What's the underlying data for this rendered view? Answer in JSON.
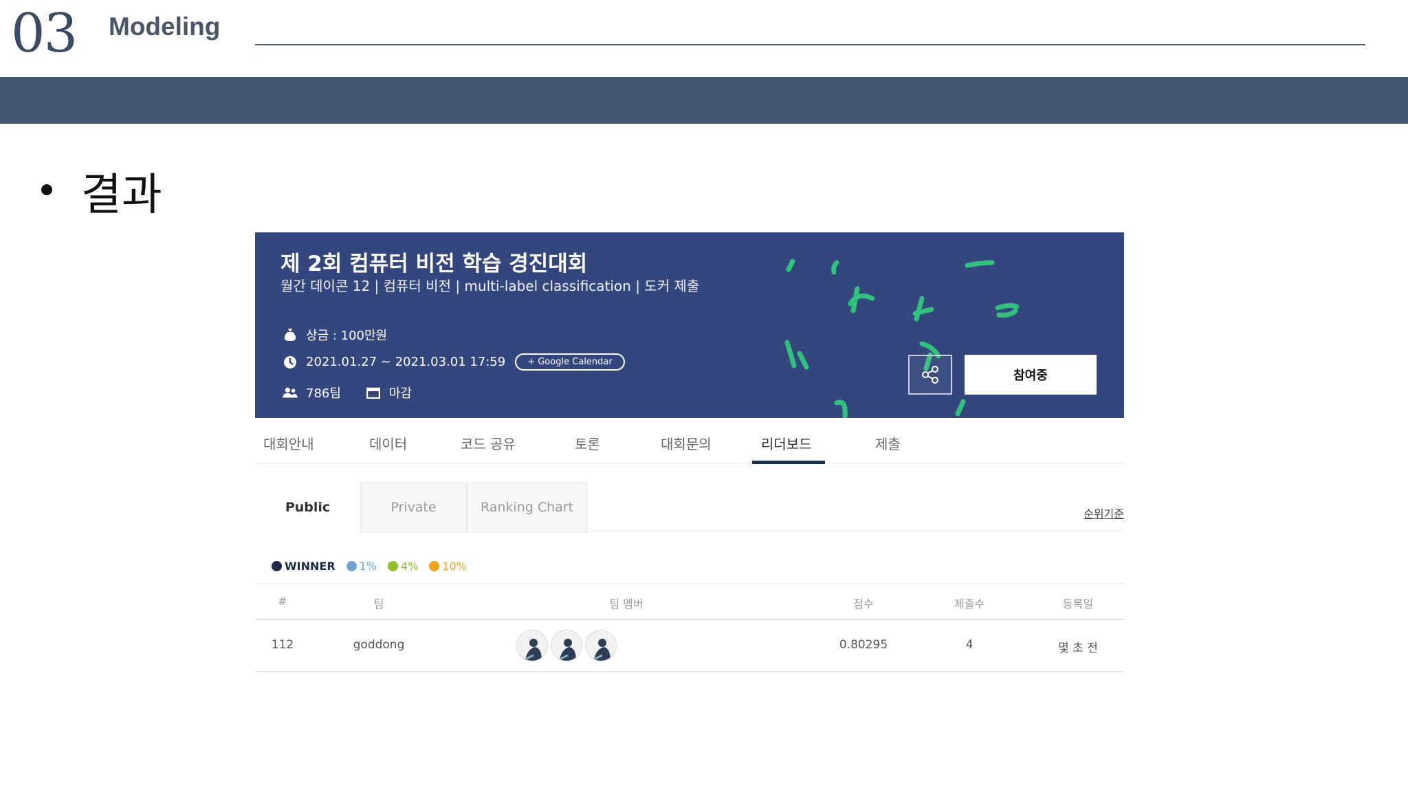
{
  "slide": {
    "number": "03",
    "title": "Modeling",
    "bullet": "결과"
  },
  "banner": {
    "title": "제 2회 컴퓨터 비전 학습 경진대회",
    "subtitle": "월간 데이콘 12 | 컴퓨터 비전 | multi-label classification | 도커 제출",
    "prize": "상금 : 100만원",
    "period": "2021.01.27 ~ 2021.03.01 17:59",
    "calendar_button": "+ Google Calendar",
    "teams": "786팀",
    "status": "마감",
    "join_button": "참여중"
  },
  "tabs": [
    {
      "label": "대회안내",
      "active": false
    },
    {
      "label": "데이터",
      "active": false
    },
    {
      "label": "코드 공유",
      "active": false
    },
    {
      "label": "토론",
      "active": false
    },
    {
      "label": "대회문의",
      "active": false
    },
    {
      "label": "리더보드",
      "active": true
    },
    {
      "label": "제출",
      "active": false
    }
  ],
  "sub_tabs": [
    {
      "label": "Public",
      "active": true
    },
    {
      "label": "Private",
      "active": false
    },
    {
      "label": "Ranking Chart",
      "active": false
    }
  ],
  "rank_criteria_link": "순위기준",
  "legend": [
    {
      "label": "WINNER",
      "color": "#1d2b45"
    },
    {
      "label": "1%",
      "color": "#6fa3cf"
    },
    {
      "label": "4%",
      "color": "#8cbf2a"
    },
    {
      "label": "10%",
      "color": "#f0a218"
    }
  ],
  "table": {
    "headers": [
      "#",
      "팀",
      "팀 멤버",
      "점수",
      "제출수",
      "등록일"
    ],
    "rows": [
      {
        "rank": "112",
        "team": "goddong",
        "members": 3,
        "score": "0.80295",
        "submissions": "4",
        "registered": "몇 초 전"
      }
    ]
  }
}
